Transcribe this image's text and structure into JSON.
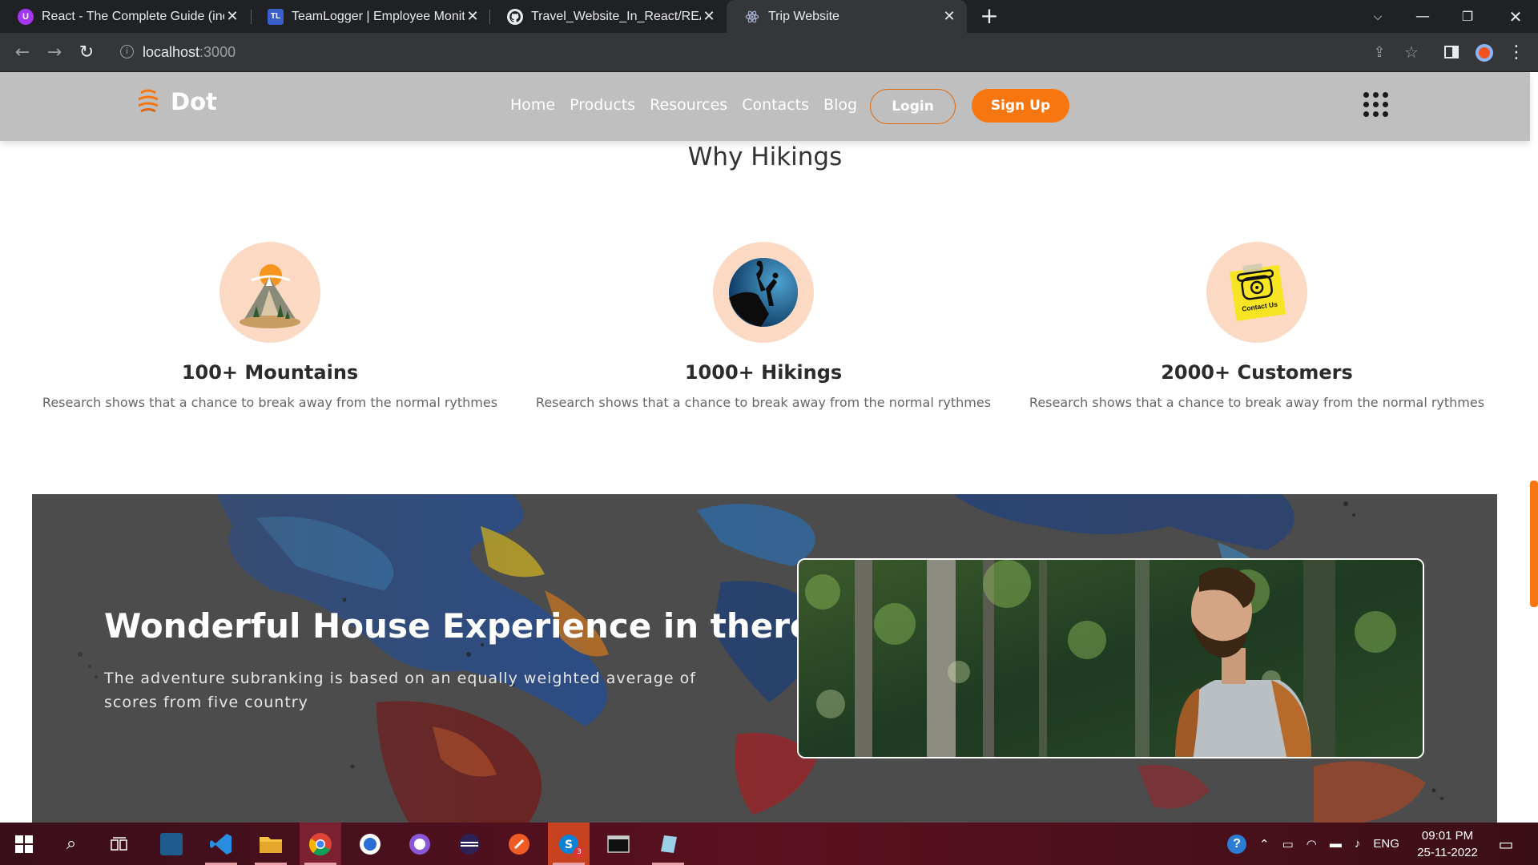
{
  "browser": {
    "tabs": [
      {
        "title": "React - The Complete Guide (incl",
        "favicon": "udemy-icon",
        "color": "#a435f0",
        "glyph": "U"
      },
      {
        "title": "TeamLogger | Employee Monitor",
        "favicon": "teamlogger-icon",
        "color": "#3b5fc8",
        "glyph": "TL"
      },
      {
        "title": "Travel_Website_In_React/READM",
        "favicon": "github-icon",
        "color": "#202124",
        "glyph": "●"
      },
      {
        "title": "Trip Website",
        "favicon": "react-icon",
        "color": "#35363a",
        "glyph": "⚛"
      }
    ],
    "address": {
      "host": "localhost",
      "port": ":3000"
    }
  },
  "site": {
    "brand": "Dot",
    "nav": [
      "Home",
      "Products",
      "Resources",
      "Contacts",
      "Blog"
    ],
    "login": "Login",
    "signup": "Sign Up",
    "accent": "#f7760f",
    "section_title": "Why Hikings",
    "features": [
      {
        "heading": "100+ Mountains",
        "desc": "Research shows that a chance to break away from the normal rythmes",
        "icon": "mountain-icon"
      },
      {
        "heading": "1000+ Hikings",
        "desc": "Research shows that a chance to break away from the normal rythmes",
        "icon": "hiker-icon"
      },
      {
        "heading": "2000+ Customers",
        "desc": "Research shows that a chance to break away from the normal rythmes",
        "icon": "contact-phone-icon",
        "icon_text": "Contact Us"
      }
    ],
    "banner": {
      "title": "Wonderful House Experience in there!",
      "text": "The adventure subranking is based on an equally weighted average of scores from five country"
    }
  },
  "taskbar": {
    "language": "ENG",
    "time": "09:01 PM",
    "date": "25-11-2022",
    "badge": "3"
  }
}
